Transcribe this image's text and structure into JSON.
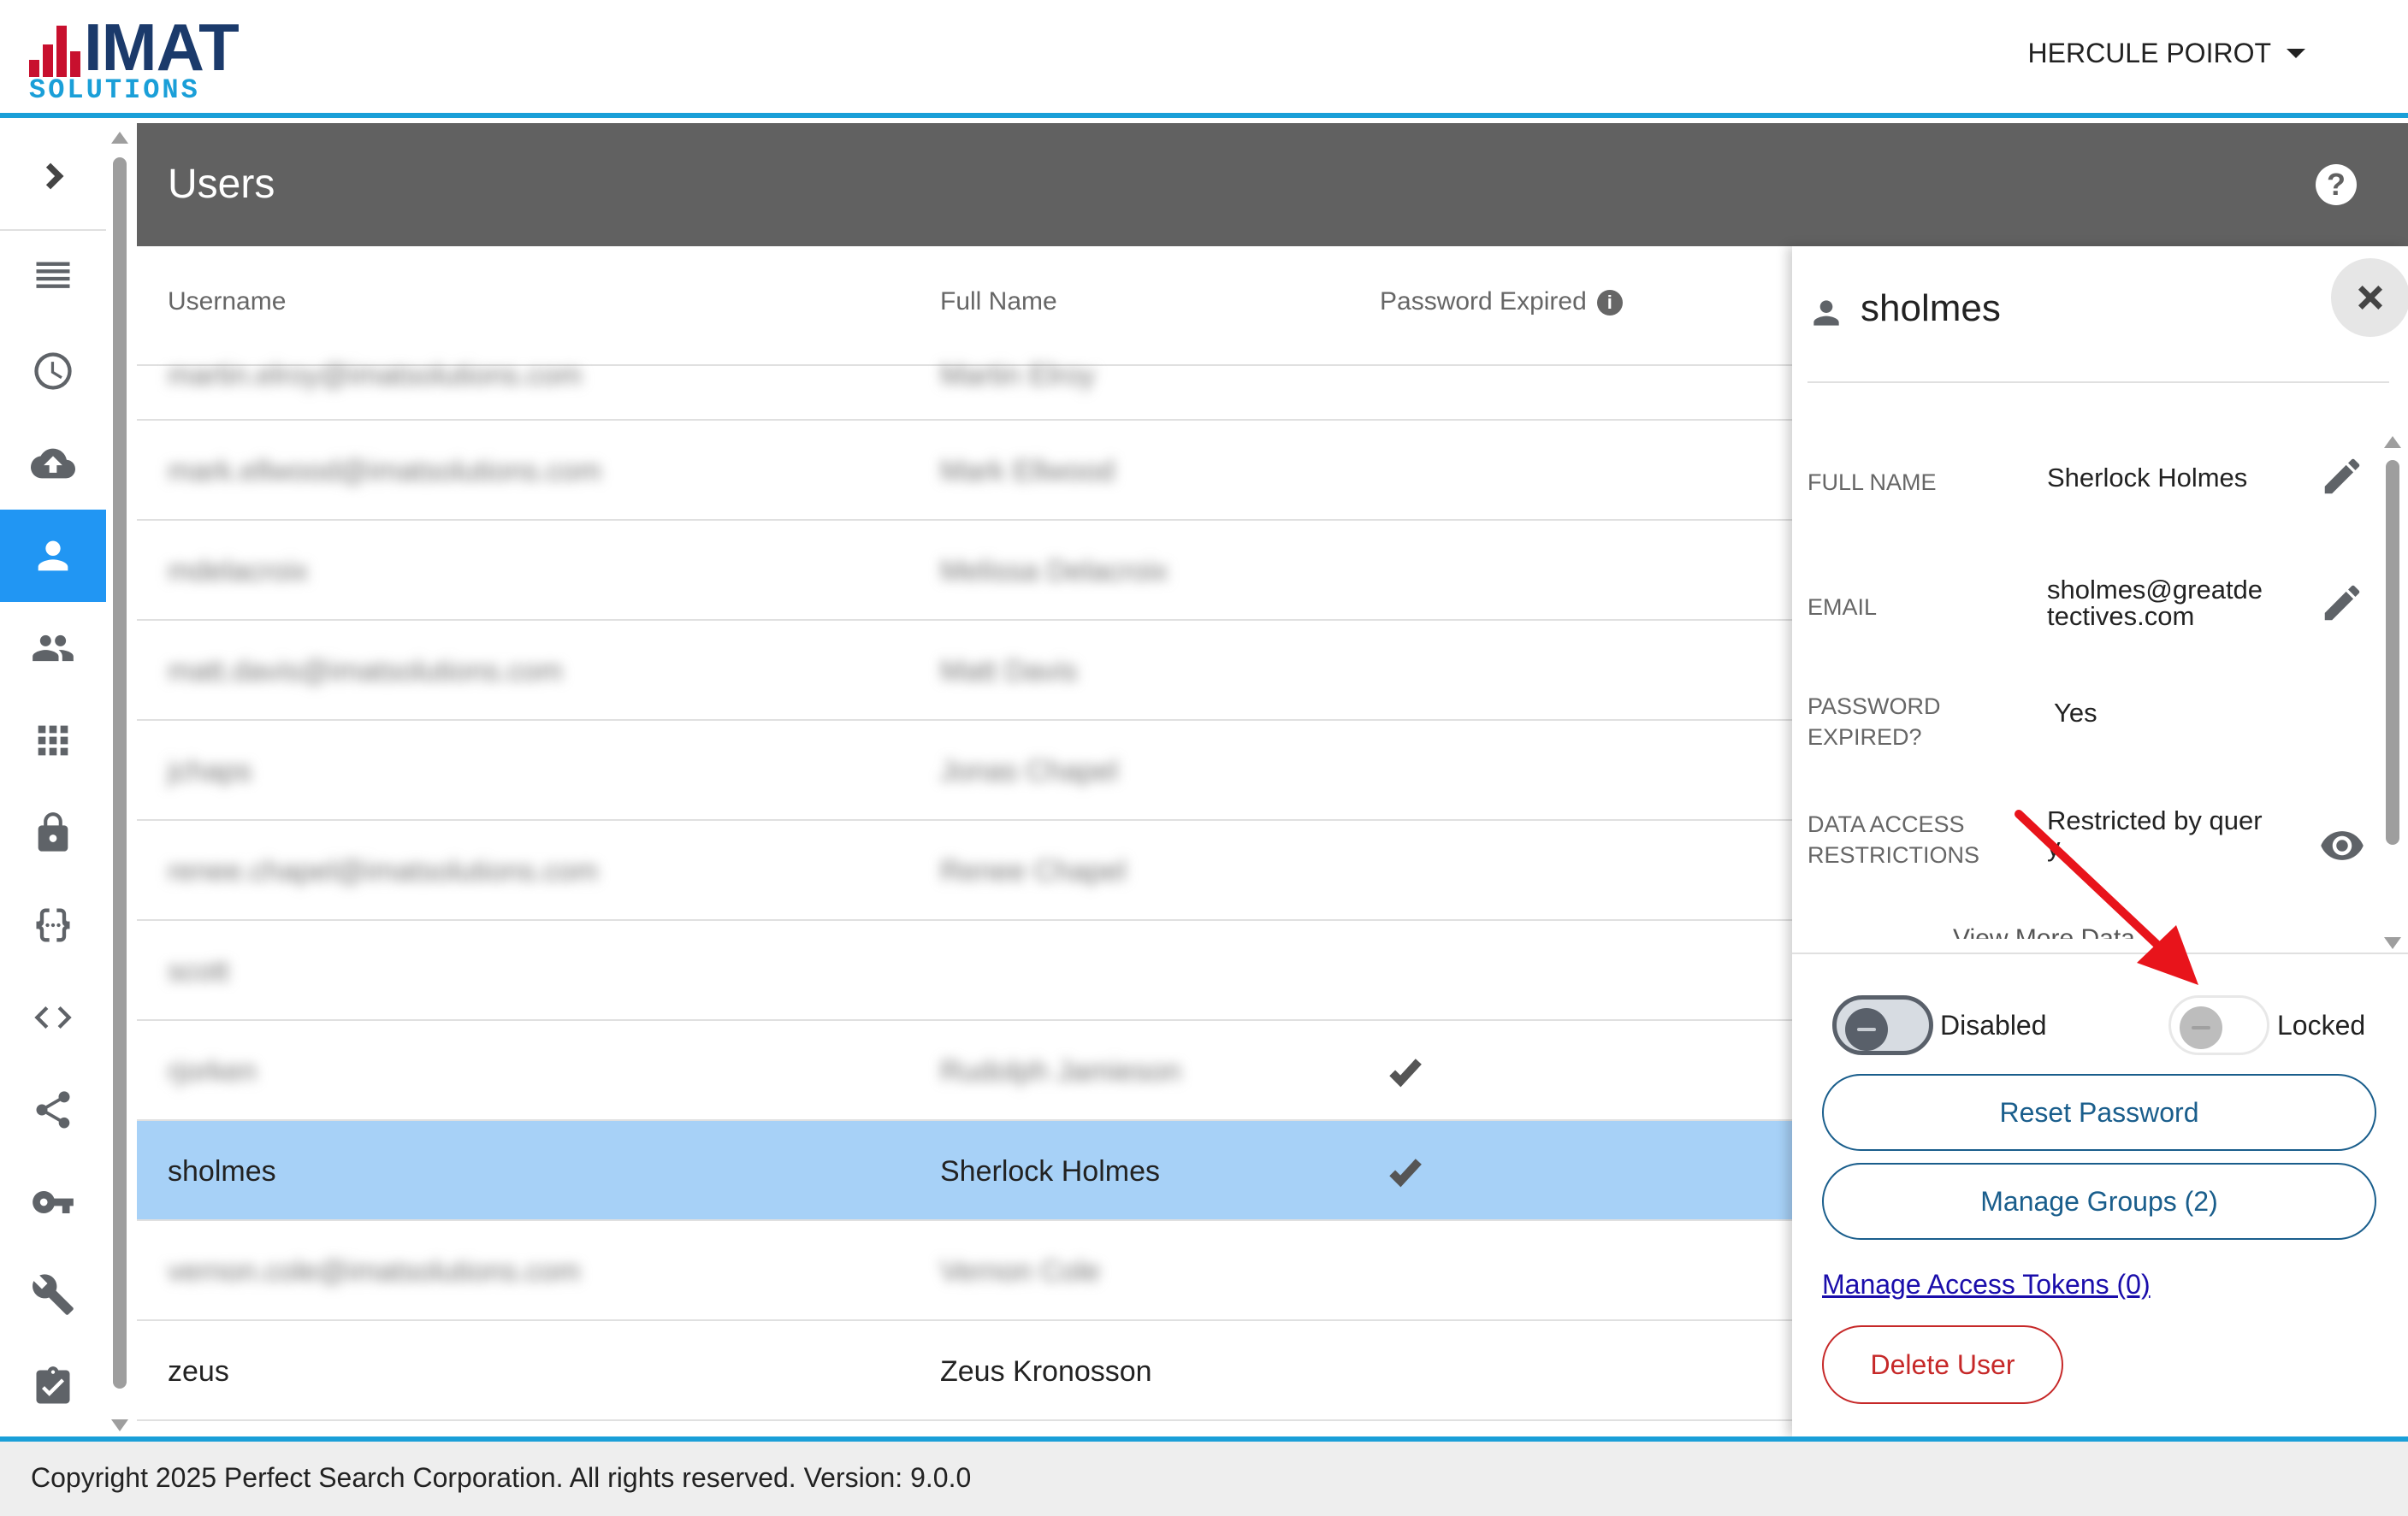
{
  "app": {
    "logo_word": "IMAT",
    "logo_sub": "SOLUTIONS",
    "brand_colors": {
      "primary": "#1a9fd8",
      "navy": "#1b3a6b",
      "red": "#c8102e",
      "selected_row": "#a7d1f7",
      "active_nav": "#2196f3"
    }
  },
  "header": {
    "user_name": "HERCULE POIROT"
  },
  "sidebar": {
    "items": [
      {
        "icon": "chevron-right-icon",
        "name": "sidebar-toggle"
      },
      {
        "icon": "list-icon",
        "name": "sidebar-item-list"
      },
      {
        "icon": "clock-icon",
        "name": "sidebar-item-history"
      },
      {
        "icon": "cloud-upload-icon",
        "name": "sidebar-item-upload"
      },
      {
        "icon": "person-icon",
        "name": "sidebar-item-users",
        "active": true
      },
      {
        "icon": "group-icon",
        "name": "sidebar-item-groups"
      },
      {
        "icon": "grid-icon",
        "name": "sidebar-item-apps"
      },
      {
        "icon": "lock-icon",
        "name": "sidebar-item-security"
      },
      {
        "icon": "braces-icon",
        "name": "sidebar-item-variables"
      },
      {
        "icon": "code-icon",
        "name": "sidebar-item-code"
      },
      {
        "icon": "share-icon",
        "name": "sidebar-item-share"
      },
      {
        "icon": "key-icon",
        "name": "sidebar-item-keys"
      },
      {
        "icon": "wrench-icon",
        "name": "sidebar-item-tools"
      },
      {
        "icon": "clipboard-check-icon",
        "name": "sidebar-item-tasks"
      }
    ]
  },
  "page": {
    "title": "Users",
    "help_label": "?"
  },
  "table": {
    "columns": {
      "username": "Username",
      "full_name": "Full Name",
      "password_expired": "Password Expired"
    },
    "rows": [
      {
        "username": "martin.elroy@imatsolutions.com",
        "full_name": "Martin Elroy",
        "expired": false,
        "blurred": true
      },
      {
        "username": "mark.ellwood@imatsolutions.com",
        "full_name": "Mark Ellwood",
        "expired": false,
        "blurred": true
      },
      {
        "username": "mdelacroix",
        "full_name": "Melissa Delacroix",
        "expired": false,
        "blurred": true
      },
      {
        "username": "matt.davis@imatsolutions.com",
        "full_name": "Matt Davis",
        "expired": false,
        "blurred": true
      },
      {
        "username": "jchaps",
        "full_name": "Jonas Chapel",
        "expired": false,
        "blurred": true
      },
      {
        "username": "renee.chapel@imatsolutions.com",
        "full_name": "Renee Chapel",
        "expired": false,
        "blurred": true
      },
      {
        "username": "scott",
        "full_name": "",
        "expired": false,
        "blurred": true
      },
      {
        "username": "rjorken",
        "full_name": "Rudolph Jamieson",
        "expired": true,
        "blurred": true
      },
      {
        "username": "sholmes",
        "full_name": "Sherlock Holmes",
        "expired": true,
        "blurred": false,
        "selected": true
      },
      {
        "username": "vernon.cole@imatsolutions.com",
        "full_name": "Vernon Cole",
        "expired": false,
        "blurred": true
      },
      {
        "username": "zeus",
        "full_name": "Zeus Kronosson",
        "expired": false,
        "blurred": false
      }
    ]
  },
  "detail": {
    "username": "sholmes",
    "full_name_label": "FULL NAME",
    "full_name_value": "Sherlock Holmes",
    "email_label": "EMAIL",
    "email_value_line1": "sholmes@greatde",
    "email_value_line2": "tectives.com",
    "password_expired_label_line1": "PASSWORD",
    "password_expired_label_line2": "EXPIRED?",
    "password_expired_value": "Yes",
    "data_access_label_line1": "DATA ACCESS",
    "data_access_label_line2": "RESTRICTIONS",
    "data_access_value_line1": "Restricted by quer",
    "data_access_value_line2": "y",
    "cutoff_text": "View More Data",
    "disabled_label": "Disabled",
    "locked_label": "Locked",
    "disabled_on": true,
    "locked_on": false,
    "reset_password": "Reset Password",
    "manage_groups": "Manage Groups (2)",
    "manage_tokens": "Manage Access Tokens (0)",
    "delete_user": "Delete User"
  },
  "footer": {
    "text": "Copyright 2025 Perfect Search Corporation. All rights reserved. Version: 9.0.0"
  }
}
